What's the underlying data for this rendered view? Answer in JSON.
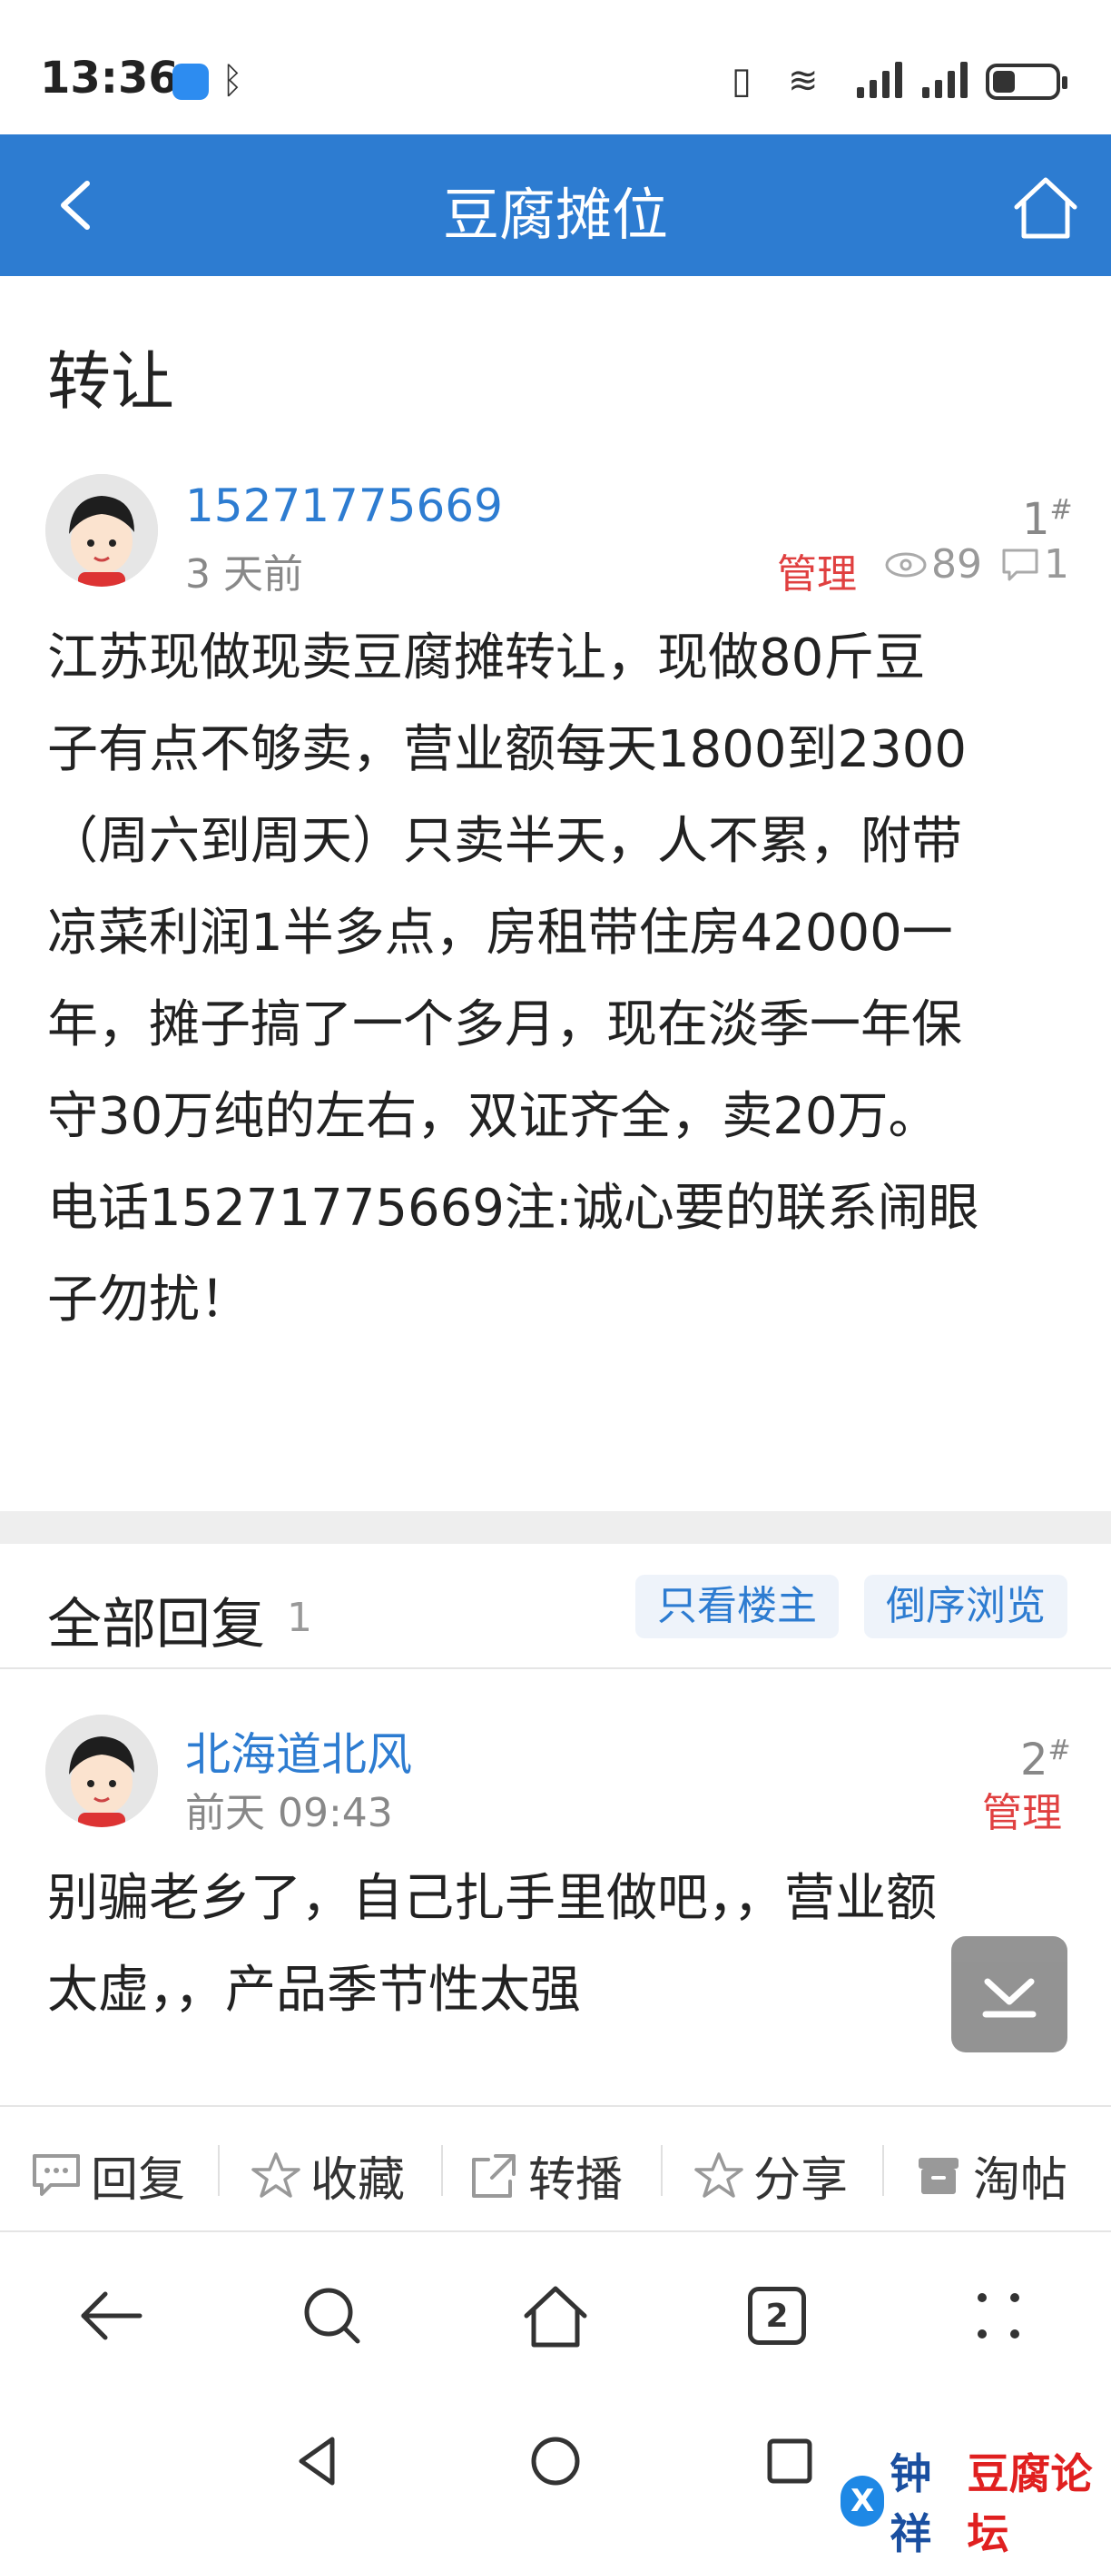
{
  "status_bar": {
    "time": "13:36"
  },
  "header": {
    "title": "豆腐摊位"
  },
  "post": {
    "title": "转让",
    "author": "15271775669",
    "time": "3 天前",
    "floor": "1",
    "floor_mark": "#",
    "admin_label": "管理",
    "views": "89",
    "comments": "1",
    "content_lines": [
      "江苏现做现卖豆腐摊转让，现做80斤豆",
      "子有点不够卖，营业额每天1800到2300",
      "（周六到周天）只卖半天，人不累，附带",
      "凉菜利润1半多点，房租带住房42000一",
      "年，摊子搞了一个多月，现在淡季一年保",
      "守30万纯的左右，双证齐全，卖20万。",
      "电话15271775669注:诚心要的联系闹眼",
      "子勿扰！"
    ]
  },
  "replies": {
    "title": "全部回复",
    "count": "1",
    "only_author_label": "只看楼主",
    "reverse_label": "倒序浏览"
  },
  "reply1": {
    "author": "北海道北风",
    "time": "前天 09:43",
    "floor": "2",
    "floor_mark": "#",
    "admin_label": "管理",
    "content_lines": [
      "别骗老乡了，自己扎手里做吧，，营业额",
      "太虚，，产品季节性太强"
    ]
  },
  "actions": {
    "reply": "回复",
    "favorite": "收藏",
    "forward": "转播",
    "share": "分享",
    "tao": "淘帖"
  },
  "browser": {
    "tabs_count": "2"
  },
  "watermark": {
    "part1": "钟祥",
    "part2": "豆腐论坛"
  }
}
